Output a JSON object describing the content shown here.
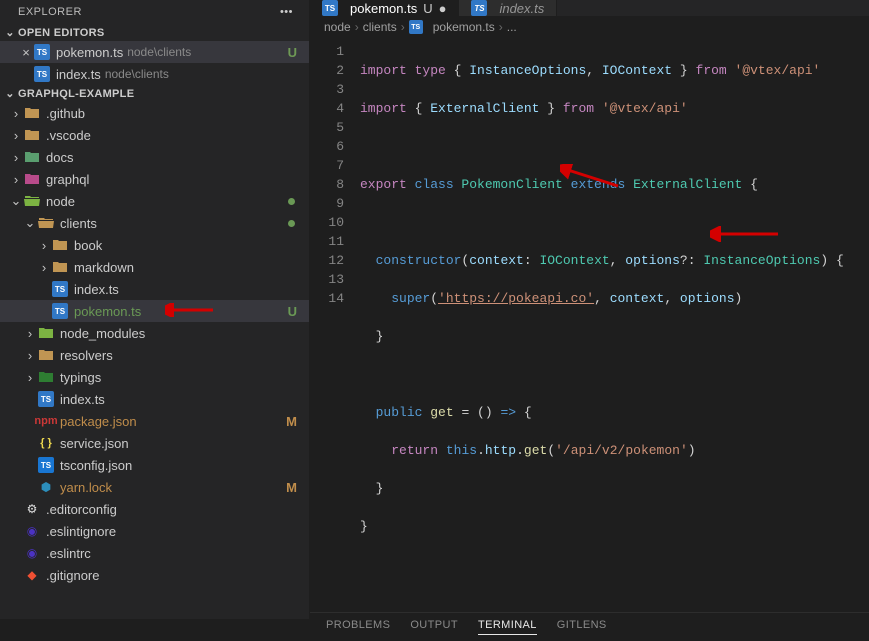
{
  "explorer": {
    "title": "EXPLORER",
    "openEditorsTitle": "OPEN EDITORS",
    "projectTitle": "GRAPHQL-EXAMPLE"
  },
  "openEditors": [
    {
      "name": "pokemon.ts",
      "path": "node\\clients",
      "status": "U",
      "active": true
    },
    {
      "name": "index.ts",
      "path": "node\\clients",
      "status": "",
      "active": false
    }
  ],
  "tree": [
    {
      "depth": 0,
      "type": "folder",
      "name": ".github",
      "expanded": false
    },
    {
      "depth": 0,
      "type": "folder",
      "name": ".vscode",
      "expanded": false
    },
    {
      "depth": 0,
      "type": "folder-docs",
      "name": "docs",
      "expanded": false
    },
    {
      "depth": 0,
      "type": "folder-graphql",
      "name": "graphql",
      "expanded": false
    },
    {
      "depth": 0,
      "type": "folder-node",
      "name": "node",
      "expanded": true,
      "dot": true
    },
    {
      "depth": 1,
      "type": "folder-open",
      "name": "clients",
      "expanded": true,
      "dot": true
    },
    {
      "depth": 2,
      "type": "folder",
      "name": "book",
      "expanded": false
    },
    {
      "depth": 2,
      "type": "folder",
      "name": "markdown",
      "expanded": false
    },
    {
      "depth": 2,
      "type": "ts",
      "name": "index.ts"
    },
    {
      "depth": 2,
      "type": "ts",
      "name": "pokemon.ts",
      "status": "U",
      "selected": true,
      "arrow": true
    },
    {
      "depth": 1,
      "type": "folder-modules",
      "name": "node_modules",
      "expanded": false
    },
    {
      "depth": 1,
      "type": "folder",
      "name": "resolvers",
      "expanded": false
    },
    {
      "depth": 1,
      "type": "folder-typings",
      "name": "typings",
      "expanded": false
    },
    {
      "depth": 1,
      "type": "ts",
      "name": "index.ts"
    },
    {
      "depth": 1,
      "type": "npm",
      "name": "package.json",
      "status": "M"
    },
    {
      "depth": 1,
      "type": "json",
      "name": "service.json"
    },
    {
      "depth": 1,
      "type": "tsconfig",
      "name": "tsconfig.json"
    },
    {
      "depth": 1,
      "type": "yarn",
      "name": "yarn.lock",
      "status": "M"
    },
    {
      "depth": 0,
      "type": "editorconfig",
      "name": ".editorconfig"
    },
    {
      "depth": 0,
      "type": "eslint",
      "name": ".eslintignore"
    },
    {
      "depth": 0,
      "type": "eslint",
      "name": ".eslintrc"
    },
    {
      "depth": 0,
      "type": "git",
      "name": ".gitignore"
    }
  ],
  "tabs": [
    {
      "name": "pokemon.ts",
      "modified": true,
      "active": true,
      "statusMark": "U"
    },
    {
      "name": "index.ts",
      "modified": false,
      "active": false,
      "statusMark": ""
    }
  ],
  "breadcrumbs": {
    "seg1": "node",
    "seg2": "clients",
    "seg3": "pokemon.ts",
    "seg4": "..."
  },
  "code": {
    "l1_a": "import",
    "l1_b": " type ",
    "l1_c": "{",
    "l1_d": " InstanceOptions",
    "l1_e": ",",
    "l1_f": " IOContext ",
    "l1_g": "}",
    "l1_h": " from ",
    "l1_i": "'@vtex/api'",
    "l2_a": "import",
    "l2_b": " {",
    "l2_c": " ExternalClient ",
    "l2_d": "}",
    "l2_e": " from ",
    "l2_f": "'@vtex/api'",
    "l4_a": "export",
    "l4_b": " class ",
    "l4_c": "PokemonClient",
    "l4_d": " extends ",
    "l4_e": "ExternalClient",
    "l4_f": " {",
    "l6_a": "  constructor",
    "l6_b": "(",
    "l6_c": "context",
    "l6_d": ":",
    "l6_e": " IOContext",
    "l6_f": ",",
    "l6_g": " options",
    "l6_h": "?:",
    "l6_i": " InstanceOptions",
    "l6_j": ") {",
    "l7_a": "    ",
    "l7_b": "super",
    "l7_c": "(",
    "l7_d": "'https://pokeapi.co'",
    "l7_e": ",",
    "l7_f": " context",
    "l7_g": ",",
    "l7_h": " options",
    "l7_i": ")",
    "l8_a": "  }",
    "l10_a": "  ",
    "l10_b": "public",
    "l10_c": " ",
    "l10_d": "get",
    "l10_e": " = () ",
    "l10_f": "=>",
    "l10_g": " {",
    "l11_a": "    ",
    "l11_b": "return",
    "l11_c": " ",
    "l11_d": "this",
    "l11_e": ".",
    "l11_f": "http",
    "l11_g": ".",
    "l11_h": "get",
    "l11_i": "(",
    "l11_j": "'/api/v2/pokemon'",
    "l11_k": ")",
    "l12_a": "  }",
    "l13_a": "}"
  },
  "lineNumbers": [
    "1",
    "2",
    "3",
    "4",
    "5",
    "6",
    "7",
    "8",
    "9",
    "10",
    "11",
    "12",
    "13",
    "14"
  ],
  "panelTabs": {
    "problems": "PROBLEMS",
    "output": "OUTPUT",
    "terminal": "TERMINAL",
    "gitlens": "GITLENS"
  }
}
